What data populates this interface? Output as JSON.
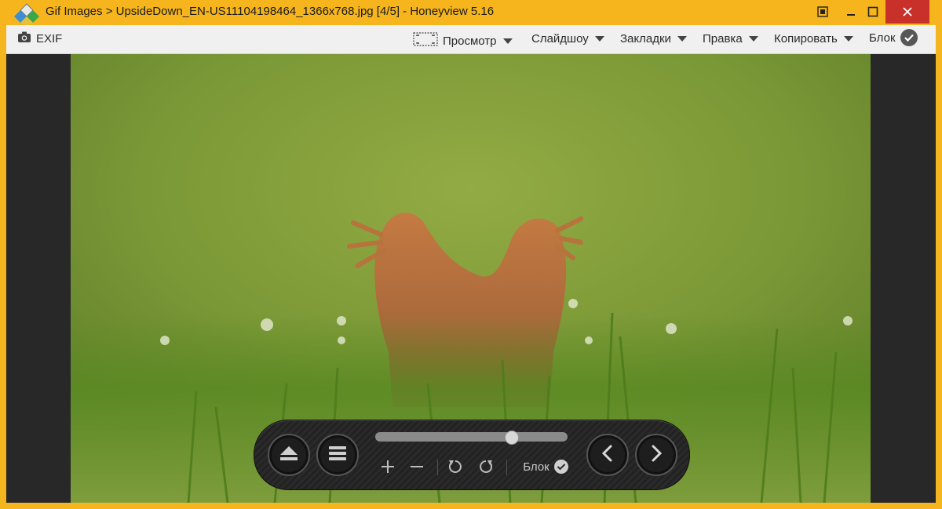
{
  "window": {
    "title": "Gif Images > UpsideDown_EN-US11104198464_1366x768.jpg [4/5] - Honeyview 5.16",
    "accent_color": "#f6b51d",
    "close_color": "#c7312a"
  },
  "toolbar": {
    "exif_label": "EXIF",
    "view_label": "Просмотр",
    "slideshow_label": "Слайдшоу",
    "bookmarks_label": "Закладки",
    "edit_label": "Правка",
    "copy_label": "Копировать",
    "block_label": "Блок"
  },
  "controls": {
    "progress": 0.72,
    "block_label": "Блок",
    "icons": [
      "eject-icon",
      "menu-icon",
      "zoom-in-icon",
      "zoom-out-icon",
      "rotate-left-icon",
      "rotate-right-icon",
      "check-icon",
      "prev-icon",
      "next-icon"
    ]
  }
}
